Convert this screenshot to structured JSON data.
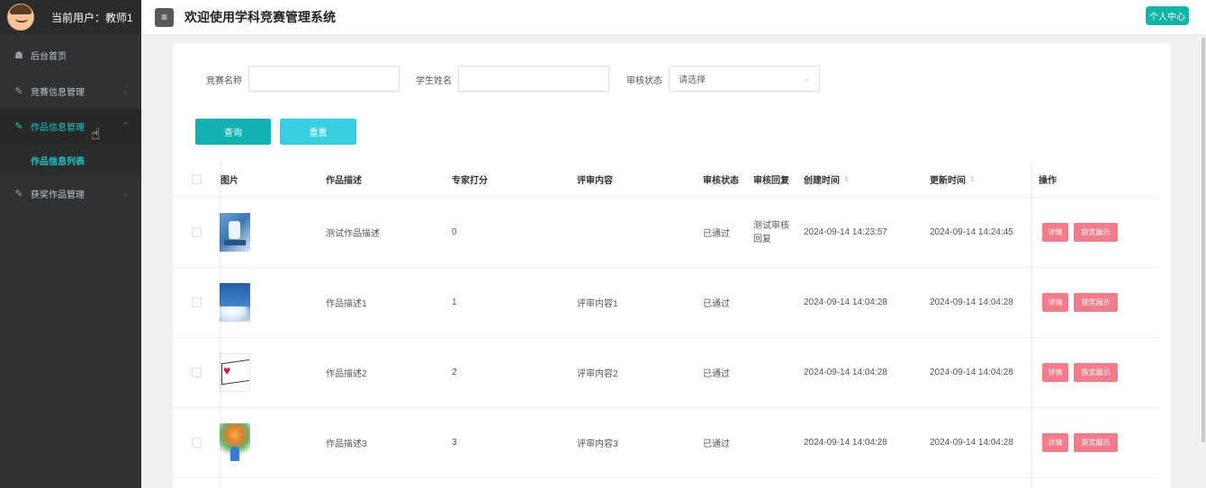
{
  "header": {
    "current_user_label": "当前用户：教师1",
    "system_title": "欢迎使用学科竞赛管理系统",
    "personal_center": "个人中心"
  },
  "sidebar": {
    "items": [
      {
        "label": "后台首页",
        "icon": "home-icon"
      },
      {
        "label": "竞赛信息管理",
        "icon": "edit-icon"
      },
      {
        "label": "作品信息管理",
        "icon": "edit-icon",
        "active": true
      },
      {
        "label": "获奖作品管理",
        "icon": "edit-icon"
      }
    ],
    "submenu": [
      {
        "label": "作品信息列表"
      }
    ]
  },
  "filters": {
    "competition_name_label": "竞赛名称",
    "competition_name_value": "",
    "student_name_label": "学生姓名",
    "student_name_value": "",
    "review_status_label": "审核状态",
    "review_status_placeholder": "请选择"
  },
  "buttons": {
    "query": "查询",
    "reset": "重置"
  },
  "table": {
    "columns": {
      "image": "图片",
      "description": "作品描述",
      "score": "专家打分",
      "review_content": "评审内容",
      "review_status": "审核状态",
      "review_reply": "审核回复",
      "created_at": "创建时间",
      "updated_at": "更新时间",
      "actions": "操作"
    },
    "rows": [
      {
        "description": "测试作品描述",
        "score": "0",
        "review_content": "",
        "review_status": "已通过",
        "review_reply": "测试审核回复",
        "created_at": "2024-09-14 14:23:57",
        "updated_at": "2024-09-14 14:24:45"
      },
      {
        "description": "作品描述1",
        "score": "1",
        "review_content": "评审内容1",
        "review_status": "已通过",
        "review_reply": "",
        "created_at": "2024-09-14 14:04:28",
        "updated_at": "2024-09-14 14:04:28"
      },
      {
        "description": "作品描述2",
        "score": "2",
        "review_content": "评审内容2",
        "review_status": "已通过",
        "review_reply": "",
        "created_at": "2024-09-14 14:04:28",
        "updated_at": "2024-09-14 14:04:28"
      },
      {
        "description": "作品描述3",
        "score": "3",
        "review_content": "评审内容3",
        "review_status": "已通过",
        "review_reply": "",
        "created_at": "2024-09-14 14:04:28",
        "updated_at": "2024-09-14 14:04:28"
      }
    ],
    "row_actions": {
      "detail": "详情",
      "award_show": "获奖展示"
    }
  },
  "colors": {
    "accent": "#13b0b4",
    "reset": "#38d0e0",
    "danger": "#f47b8a",
    "sidebar_bg": "#2f3133"
  }
}
